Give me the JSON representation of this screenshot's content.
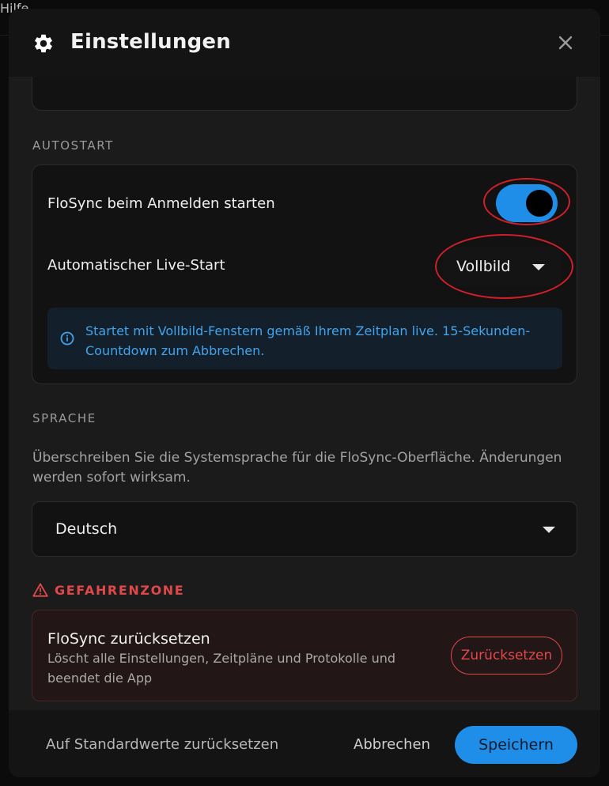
{
  "background": {
    "menu_text": "Hilfe"
  },
  "dialog": {
    "title": "Einstellungen",
    "title_icon": "gear-icon",
    "close_icon": "close-icon"
  },
  "autostart": {
    "section_title": "AUTOSTART",
    "login_label": "FloSync beim Anmelden starten",
    "login_enabled": true,
    "live_label": "Automatischer Live-Start",
    "live_value": "Vollbild",
    "info_text": "Startet mit Vollbild-Fenstern gemäß Ihrem Zeitplan live. 15-Sekunden-Countdown zum Abbrechen."
  },
  "language": {
    "section_title": "SPRACHE",
    "description": "Überschreiben Sie die Systemsprache für die FloSync-Oberfläche. Änderungen werden sofort wirksam.",
    "value": "Deutsch"
  },
  "danger": {
    "section_title": "GEFAHRENZONE",
    "reset_title": "FloSync zurücksetzen",
    "reset_desc": "Löscht alle Einstellungen, Zeitpläne und Protokolle und beendet die App",
    "reset_button": "Zurücksetzen"
  },
  "footer": {
    "defaults_label": "Auf Standardwerte zurücksetzen",
    "cancel_label": "Abbrechen",
    "save_label": "Speichern"
  },
  "colors": {
    "accent": "#1e8ee8",
    "danger": "#e0484a",
    "annotation": "#d01f2a",
    "info_text": "#42a3ec"
  }
}
